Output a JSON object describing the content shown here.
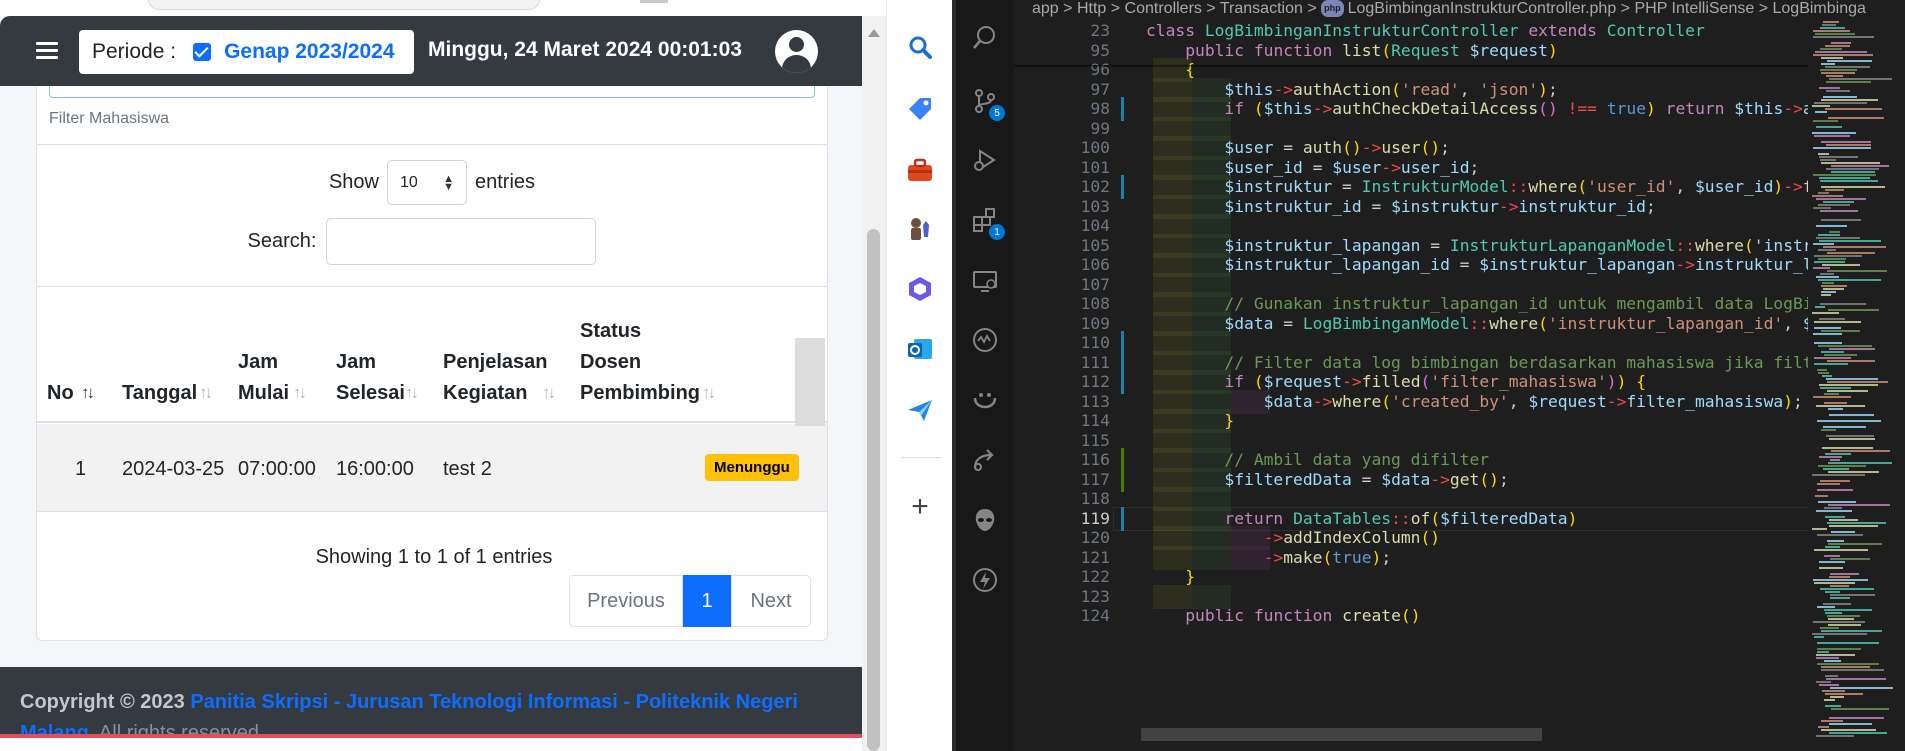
{
  "webapp": {
    "periode_label": "Periode :",
    "periode_value": "Genap 2023/2024",
    "datetime": "Minggu, 24 Maret 2024 00:01:03",
    "filter_label": "Filter Mahasiswa",
    "show_label": "Show",
    "entries_value": "10",
    "entries_label": "entries",
    "search_label": "Search:",
    "search_value": "",
    "columns": [
      {
        "l1": "",
        "l2": "",
        "l3": "No"
      },
      {
        "l1": "",
        "l2": "",
        "l3": "Tanggal"
      },
      {
        "l1": "",
        "l2": "Jam",
        "l3": "Mulai"
      },
      {
        "l1": "",
        "l2": "Jam",
        "l3": "Selesai"
      },
      {
        "l1": "",
        "l2": "Penjelasan",
        "l3": "Kegiatan"
      },
      {
        "l1": "Status",
        "l2": "Dosen",
        "l3": "Pembimbing"
      }
    ],
    "rows": [
      {
        "no": "1",
        "tanggal": "2024-03-25",
        "jam_mulai": "07:00:00",
        "jam_selesai": "16:00:00",
        "penjelasan": "test 2",
        "status": "Menunggu"
      }
    ],
    "showing_text": "Showing 1 to 1 of 1 entries",
    "pagination": {
      "previous": "Previous",
      "current": "1",
      "next": "Next"
    },
    "footer": {
      "copyright": "Copyright © 2023",
      "link_text": "Panitia Skripsi - Jurusan Teknologi Informasi - Politeknik Negeri Malang",
      "rights": ". All rights reserved."
    }
  },
  "side_panel": {
    "icons": [
      "search-icon",
      "tag-icon",
      "toolbox-icon",
      "chess-icon",
      "copilot-icon",
      "outlook-icon",
      "send-icon",
      "add-icon"
    ]
  },
  "vscode": {
    "breadcrumb": [
      "app",
      ">",
      "Http",
      ">",
      "Controllers",
      ">",
      "Transaction",
      ">",
      "LogBimbinganInstrukturController.php",
      ">",
      "PHP IntelliSense",
      ">",
      "LogBimbinga"
    ],
    "php_badge": "php",
    "activity_badges": {
      "source_control": "5",
      "extensions": "1"
    },
    "lines": [
      {
        "n": "23",
        "text": "class LogBimbinganInstrukturController extends Controller"
      },
      {
        "n": "95",
        "text": "    public function list(Request $request)"
      },
      {
        "n": "96",
        "text": "    {"
      },
      {
        "n": "97",
        "text": "        $this->authAction('read', 'json');"
      },
      {
        "n": "98",
        "text": "        if ($this->authCheckDetailAccess() !== true) return $this->authChe"
      },
      {
        "n": "99",
        "text": ""
      },
      {
        "n": "100",
        "text": "        $user = auth()->user();"
      },
      {
        "n": "101",
        "text": "        $user_id = $user->user_id;"
      },
      {
        "n": "102",
        "text": "        $instruktur = InstrukturModel::where('user_id', $user_id)->first()"
      },
      {
        "n": "103",
        "text": "        $instruktur_id = $instruktur->instruktur_id;"
      },
      {
        "n": "104",
        "text": ""
      },
      {
        "n": "105",
        "text": "        $instruktur_lapangan = InstrukturLapanganModel::where('instruktur_"
      },
      {
        "n": "106",
        "text": "        $instruktur_lapangan_id = $instruktur_lapangan->instruktur_lapangan"
      },
      {
        "n": "107",
        "text": ""
      },
      {
        "n": "108",
        "text": "        // Gunakan instruktur_lapangan_id untuk mengambil data LogBimbingan"
      },
      {
        "n": "109",
        "text": "        $data = LogBimbinganModel::where('instruktur_lapangan_id', $instru"
      },
      {
        "n": "110",
        "text": ""
      },
      {
        "n": "111",
        "text": "        // Filter data log bimbingan berdasarkan mahasiswa jika filter mah"
      },
      {
        "n": "112",
        "text": "        if ($request->filled('filter_mahasiswa')) {"
      },
      {
        "n": "113",
        "text": "            $data->where('created_by', $request->filter_mahasiswa);"
      },
      {
        "n": "114",
        "text": "        }"
      },
      {
        "n": "115",
        "text": ""
      },
      {
        "n": "116",
        "text": "        // Ambil data yang difilter"
      },
      {
        "n": "117",
        "text": "        $filteredData = $data->get();"
      },
      {
        "n": "118",
        "text": ""
      },
      {
        "n": "119",
        "text": "        return DataTables::of($filteredData)"
      },
      {
        "n": "120",
        "text": "            ->addIndexColumn()"
      },
      {
        "n": "121",
        "text": "            ->make(true);"
      },
      {
        "n": "122",
        "text": "    }"
      },
      {
        "n": "123",
        "text": ""
      },
      {
        "n": "124",
        "text": "    public function create()"
      }
    ],
    "current_line": "119"
  },
  "colors": {
    "navbar": "#343a40",
    "primary": "#0d6efd",
    "badge_warning": "#ffc107",
    "vscode_bg": "#1e1e1e"
  }
}
